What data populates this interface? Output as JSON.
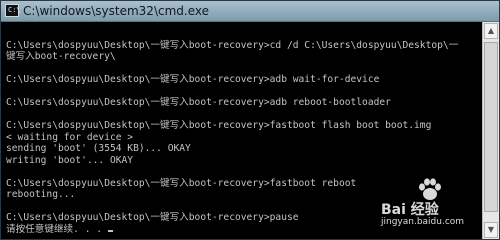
{
  "window": {
    "title": "C:\\windows\\system32\\cmd.exe",
    "icon_name": "cmd-app-icon",
    "icon_glyph": "C:\\"
  },
  "console": {
    "lines": [
      "",
      "C:\\Users\\dospyuu\\Desktop\\一键写入boot-recovery>cd /d C:\\Users\\dospyuu\\Desktop\\一",
      "键写入boot-recovery\\",
      "",
      "C:\\Users\\dospyuu\\Desktop\\一键写入boot-recovery>adb wait-for-device",
      "",
      "C:\\Users\\dospyuu\\Desktop\\一键写入boot-recovery>adb reboot-bootloader",
      "",
      "C:\\Users\\dospyuu\\Desktop\\一键写入boot-recovery>fastboot flash boot boot.img",
      "< waiting for device >",
      "sending 'boot' (3554 KB)... OKAY",
      "writing 'boot'... OKAY",
      "",
      "C:\\Users\\dospyuu\\Desktop\\一键写入boot-recovery>fastboot reboot",
      "rebooting...",
      "",
      "C:\\Users\\dospyuu\\Desktop\\一键写入boot-recovery>pause",
      "请按任意键继续. . . "
    ]
  },
  "scrollbar": {
    "up_icon": "▲",
    "down_icon": "▼"
  },
  "watermark": {
    "main": "Bai 经验",
    "sub": "jingyan.baidu.com"
  },
  "colors": {
    "console_bg": "#000000",
    "console_text": "#c4c4c4",
    "titlebar": "#9db6c6"
  }
}
